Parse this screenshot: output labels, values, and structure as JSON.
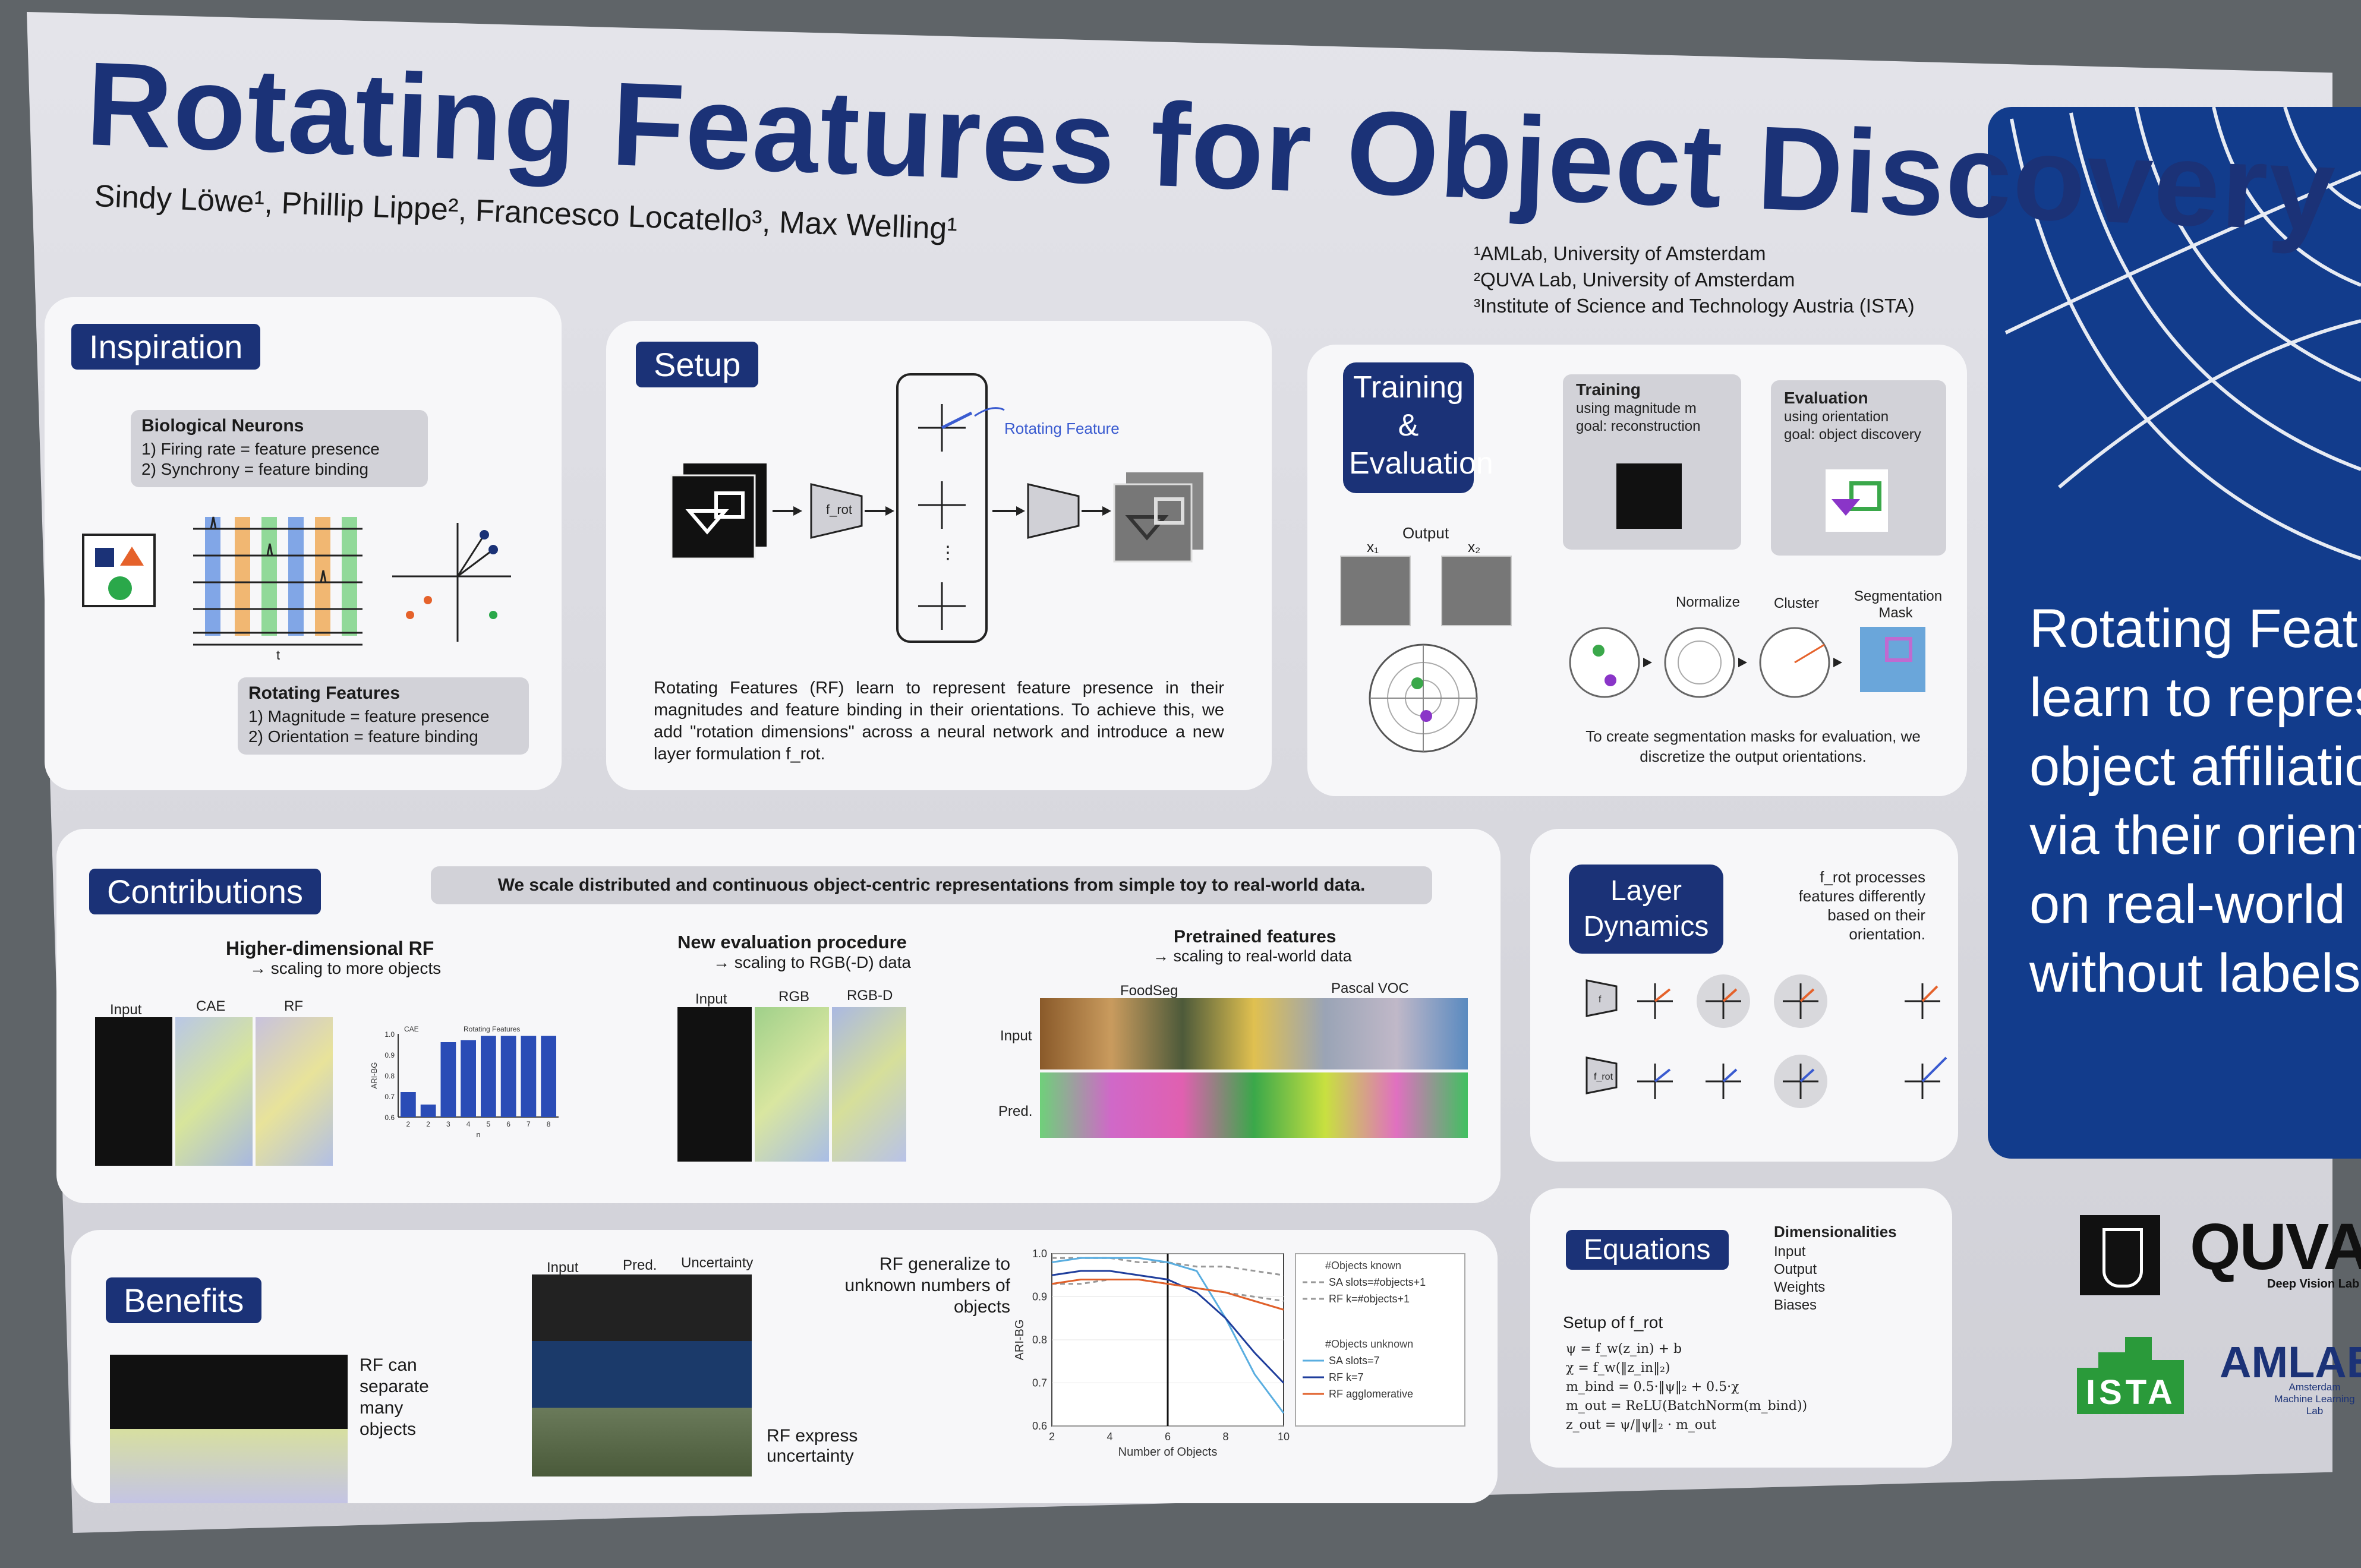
{
  "poster": {
    "title": "Rotating Features for Object Discovery",
    "authors": "Sindy Löwe¹, Phillip Lippe², Francesco Locatello³, Max Welling¹",
    "affiliations": [
      "¹AMLab, University of Amsterdam",
      "²QUVA Lab, University of Amsterdam",
      "³Institute of Science and Technology Austria (ISTA)"
    ]
  },
  "inspiration": {
    "header": "Inspiration",
    "bio_title": "Biological Neurons",
    "bio_lines": [
      "1) Firing rate = feature presence",
      "2) Synchrony = feature binding"
    ],
    "rf_title": "Rotating Features",
    "rf_lines": [
      "1) Magnitude = feature presence",
      "2) Orientation = feature binding"
    ],
    "axis_label": "t"
  },
  "setup": {
    "header": "Setup",
    "rotating_feature_label": "Rotating Feature",
    "frot": "f_rot",
    "description": "Rotating Features (RF) learn to represent feature presence in their magnitudes and feature binding in their orientations. To achieve this, we add \"rotation dimensions\" across a neural network and introduce a new layer formulation f_rot."
  },
  "training": {
    "header": "Training & Evaluation",
    "training_title": "Training",
    "training_lines": [
      "using magnitude m",
      "goal: reconstruction"
    ],
    "evaluation_title": "Evaluation",
    "evaluation_lines": [
      "using orientation",
      "goal: object discovery"
    ],
    "output_label": "Output",
    "x1": "x₁",
    "x2": "x₂",
    "normalize": "Normalize",
    "cluster": "Cluster",
    "segmentation": "Segmentation Mask",
    "caption": "To create segmentation masks for evaluation, we discretize the output orientations."
  },
  "contributions": {
    "header": "Contributions",
    "banner": "We scale distributed and continuous object-centric representations from simple toy to real-world data.",
    "col1_title": "Higher-dimensional RF",
    "col1_sub": "→ scaling to more objects",
    "col1_labels": [
      "Input",
      "CAE",
      "RF"
    ],
    "col2_title": "New evaluation procedure",
    "col2_sub": "→ scaling to RGB(-D) data",
    "col2_labels": [
      "Input",
      "RGB",
      "RGB-D"
    ],
    "col3_title": "Pretrained features",
    "col3_sub": "→ scaling to real-world data",
    "col3_labels": [
      "FoodSeg",
      "Pascal VOC"
    ],
    "row_labels": [
      "Input",
      "Pred."
    ]
  },
  "layer_dynamics": {
    "header": "Layer Dynamics",
    "text": "f_rot processes features differently based on their orientation.",
    "row_labels": [
      "f",
      "f_rot"
    ]
  },
  "benefits": {
    "header": "Benefits",
    "separate": "RF can separate many objects",
    "uncertainty": "RF express uncertainty",
    "generalize": "RF generalize to unknown numbers of objects",
    "grid_labels": [
      "Input",
      "Pred.",
      "Uncertainty"
    ]
  },
  "equations": {
    "header": "Equations",
    "dims_title": "Dimensionalities",
    "dims": [
      "Input",
      "Output",
      "Weights",
      "Biases"
    ],
    "setup_title": "Setup of f_rot",
    "lines": [
      "ψ = f_w(z_in) + b",
      "χ = f_w(‖z_in‖₂)",
      "m_bind = 0.5·‖ψ‖₂ + 0.5·χ",
      "m_out = ReLU(BatchNorm(m_bind))",
      "z_out = ψ/‖ψ‖₂ · m_out"
    ]
  },
  "side_panel": {
    "lines": [
      "Rotating Featu",
      "learn to represe",
      "object affiliatio",
      "via their orienta",
      "on real-world d",
      "without labels."
    ]
  },
  "logos": {
    "quva": "QUVA",
    "quva_sub": "Deep Vision Lab",
    "ista": "ISTA",
    "amlab": "AMLAB",
    "amlab_sub": "Amsterdam Machine Learning Lab"
  },
  "chart_data": [
    {
      "type": "bar",
      "title": "",
      "series_labels": [
        "CAE",
        "Rotating Features"
      ],
      "categories": [
        "2",
        "2",
        "3",
        "4",
        "5",
        "6",
        "7",
        "8"
      ],
      "values": [
        0.72,
        0.66,
        0.96,
        0.97,
        0.99,
        0.99,
        0.99,
        0.99
      ],
      "xlabel": "n",
      "ylabel": "ARI-BG",
      "ylim": [
        0.6,
        1.0
      ],
      "yticks": [
        "0.6",
        "0.7",
        "0.8",
        "0.9",
        "1.0"
      ],
      "color": "#2a4cb6"
    },
    {
      "type": "line",
      "xlabel": "Number of Objects",
      "ylabel": "ARI-BG",
      "xticks": [
        "2",
        "4",
        "6",
        "8",
        "10"
      ],
      "yticks": [
        "0.6",
        "0.7",
        "0.8",
        "0.9",
        "1.0"
      ],
      "xlim": [
        2,
        10
      ],
      "ylim": [
        0.6,
        1.0
      ],
      "legend_known_title": "#Objects known",
      "legend_unknown_title": "#Objects unknown",
      "series": [
        {
          "name": "SA slots=#objects+1",
          "color": "#999999",
          "dash": true,
          "x": [
            2,
            3,
            4,
            5,
            6,
            7,
            8,
            9,
            10
          ],
          "y": [
            0.99,
            0.99,
            0.99,
            0.98,
            0.98,
            0.97,
            0.97,
            0.96,
            0.95
          ]
        },
        {
          "name": "RF k=#objects+1",
          "color": "#999999",
          "dash": true,
          "x": [
            2,
            3,
            4,
            5,
            6,
            7,
            8,
            9,
            10
          ],
          "y": [
            0.93,
            0.93,
            0.94,
            0.94,
            0.93,
            0.92,
            0.91,
            0.9,
            0.89
          ]
        },
        {
          "name": "SA slots=7",
          "color": "#5aaee0",
          "dash": false,
          "x": [
            2,
            3,
            4,
            5,
            6,
            7,
            8,
            9,
            10
          ],
          "y": [
            0.98,
            0.99,
            0.99,
            0.99,
            0.98,
            0.96,
            0.85,
            0.72,
            0.63
          ]
        },
        {
          "name": "RF k=7",
          "color": "#1f3e9c",
          "dash": false,
          "x": [
            2,
            3,
            4,
            5,
            6,
            7,
            8,
            9,
            10
          ],
          "y": [
            0.95,
            0.96,
            0.96,
            0.95,
            0.94,
            0.91,
            0.85,
            0.77,
            0.7
          ]
        },
        {
          "name": "RF agglomerative",
          "color": "#e0602a",
          "dash": false,
          "x": [
            2,
            3,
            4,
            5,
            6,
            7,
            8,
            9,
            10
          ],
          "y": [
            0.93,
            0.94,
            0.94,
            0.94,
            0.93,
            0.92,
            0.91,
            0.89,
            0.87
          ]
        }
      ]
    }
  ]
}
